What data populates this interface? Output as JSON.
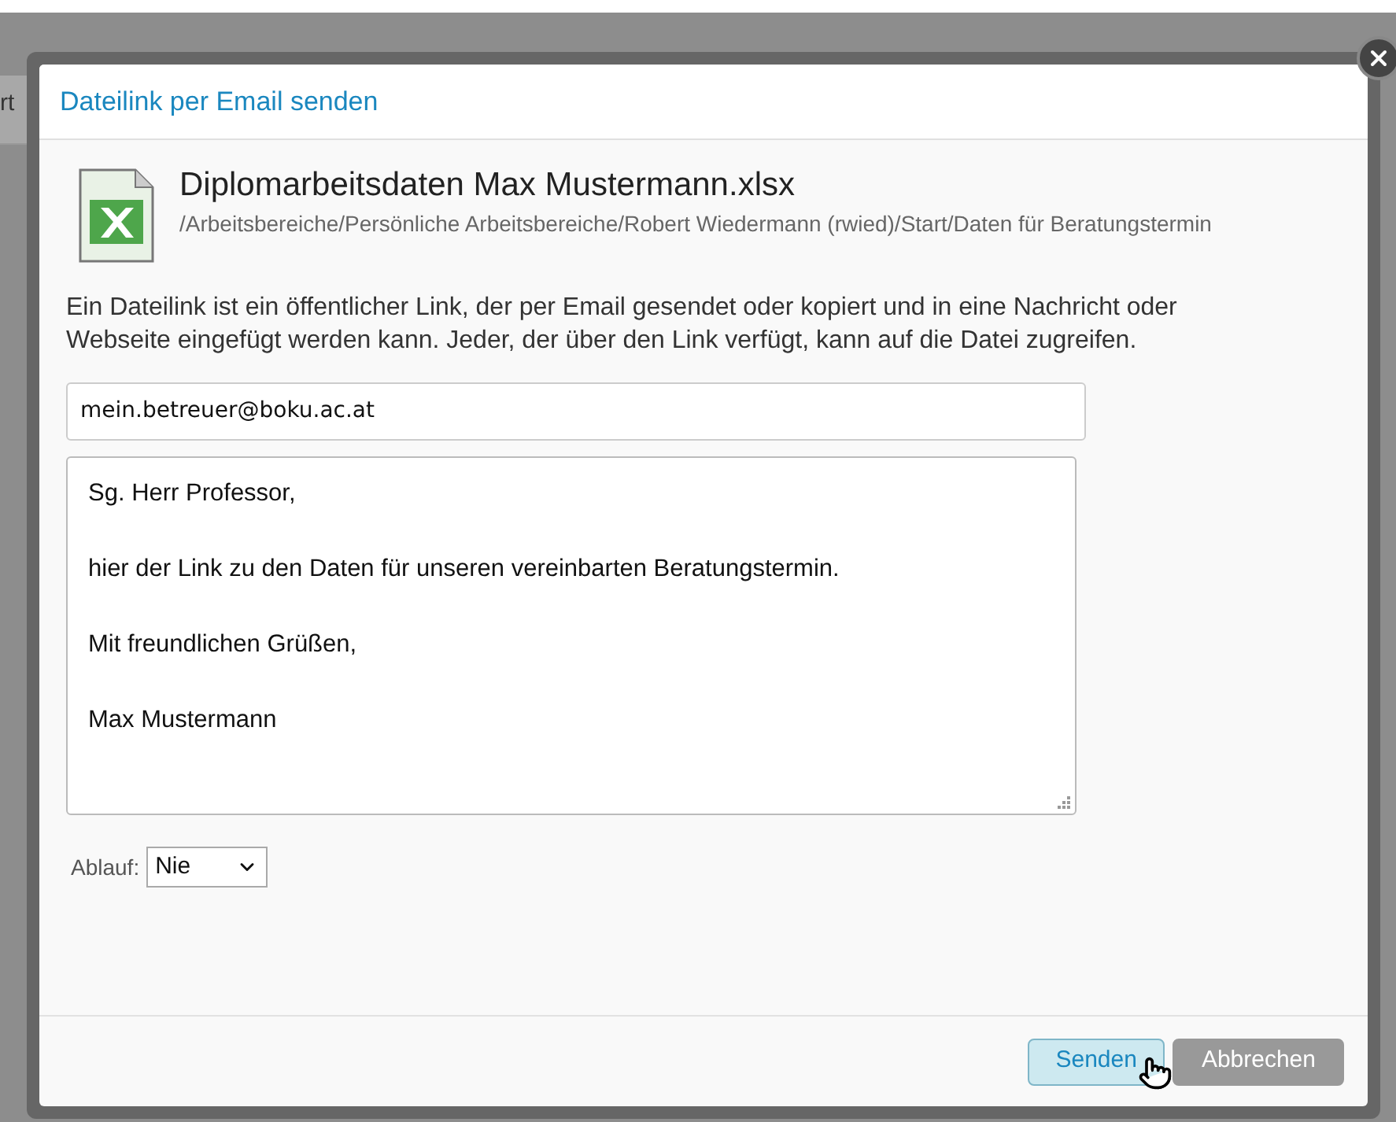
{
  "background_text": "rt",
  "dialog": {
    "title": "Dateilink per Email senden",
    "file": {
      "name": "Diplomarbeitsdaten Max Mustermann.xlsx",
      "path": "/Arbeitsbereiche/Persönliche Arbeitsbereiche/Robert Wiedermann (rwied)/Start/Daten für Beratungstermin"
    },
    "description": "Ein Dateilink ist ein öffentlicher Link, der per Email gesendet oder kopiert und in eine Nachricht oder Webseite eingefügt werden kann. Jeder, der über den Link verfügt, kann auf die Datei zugreifen.",
    "recipient": {
      "value": "mein.betreuer@boku.ac.at"
    },
    "message": [
      "Sg. Herr Professor,",
      "hier der Link zu den Daten für unseren vereinbarten  Beratungstermin.",
      "Mit freundlichen Grüßen,",
      "Max Mustermann"
    ],
    "expiry": {
      "label": "Ablauf:",
      "value": "Nie"
    },
    "buttons": [
      {
        "label": "Senden",
        "kind": "primary",
        "hovered": true
      },
      {
        "label": "Abbrechen",
        "kind": "secondary",
        "hovered": false
      }
    ]
  }
}
